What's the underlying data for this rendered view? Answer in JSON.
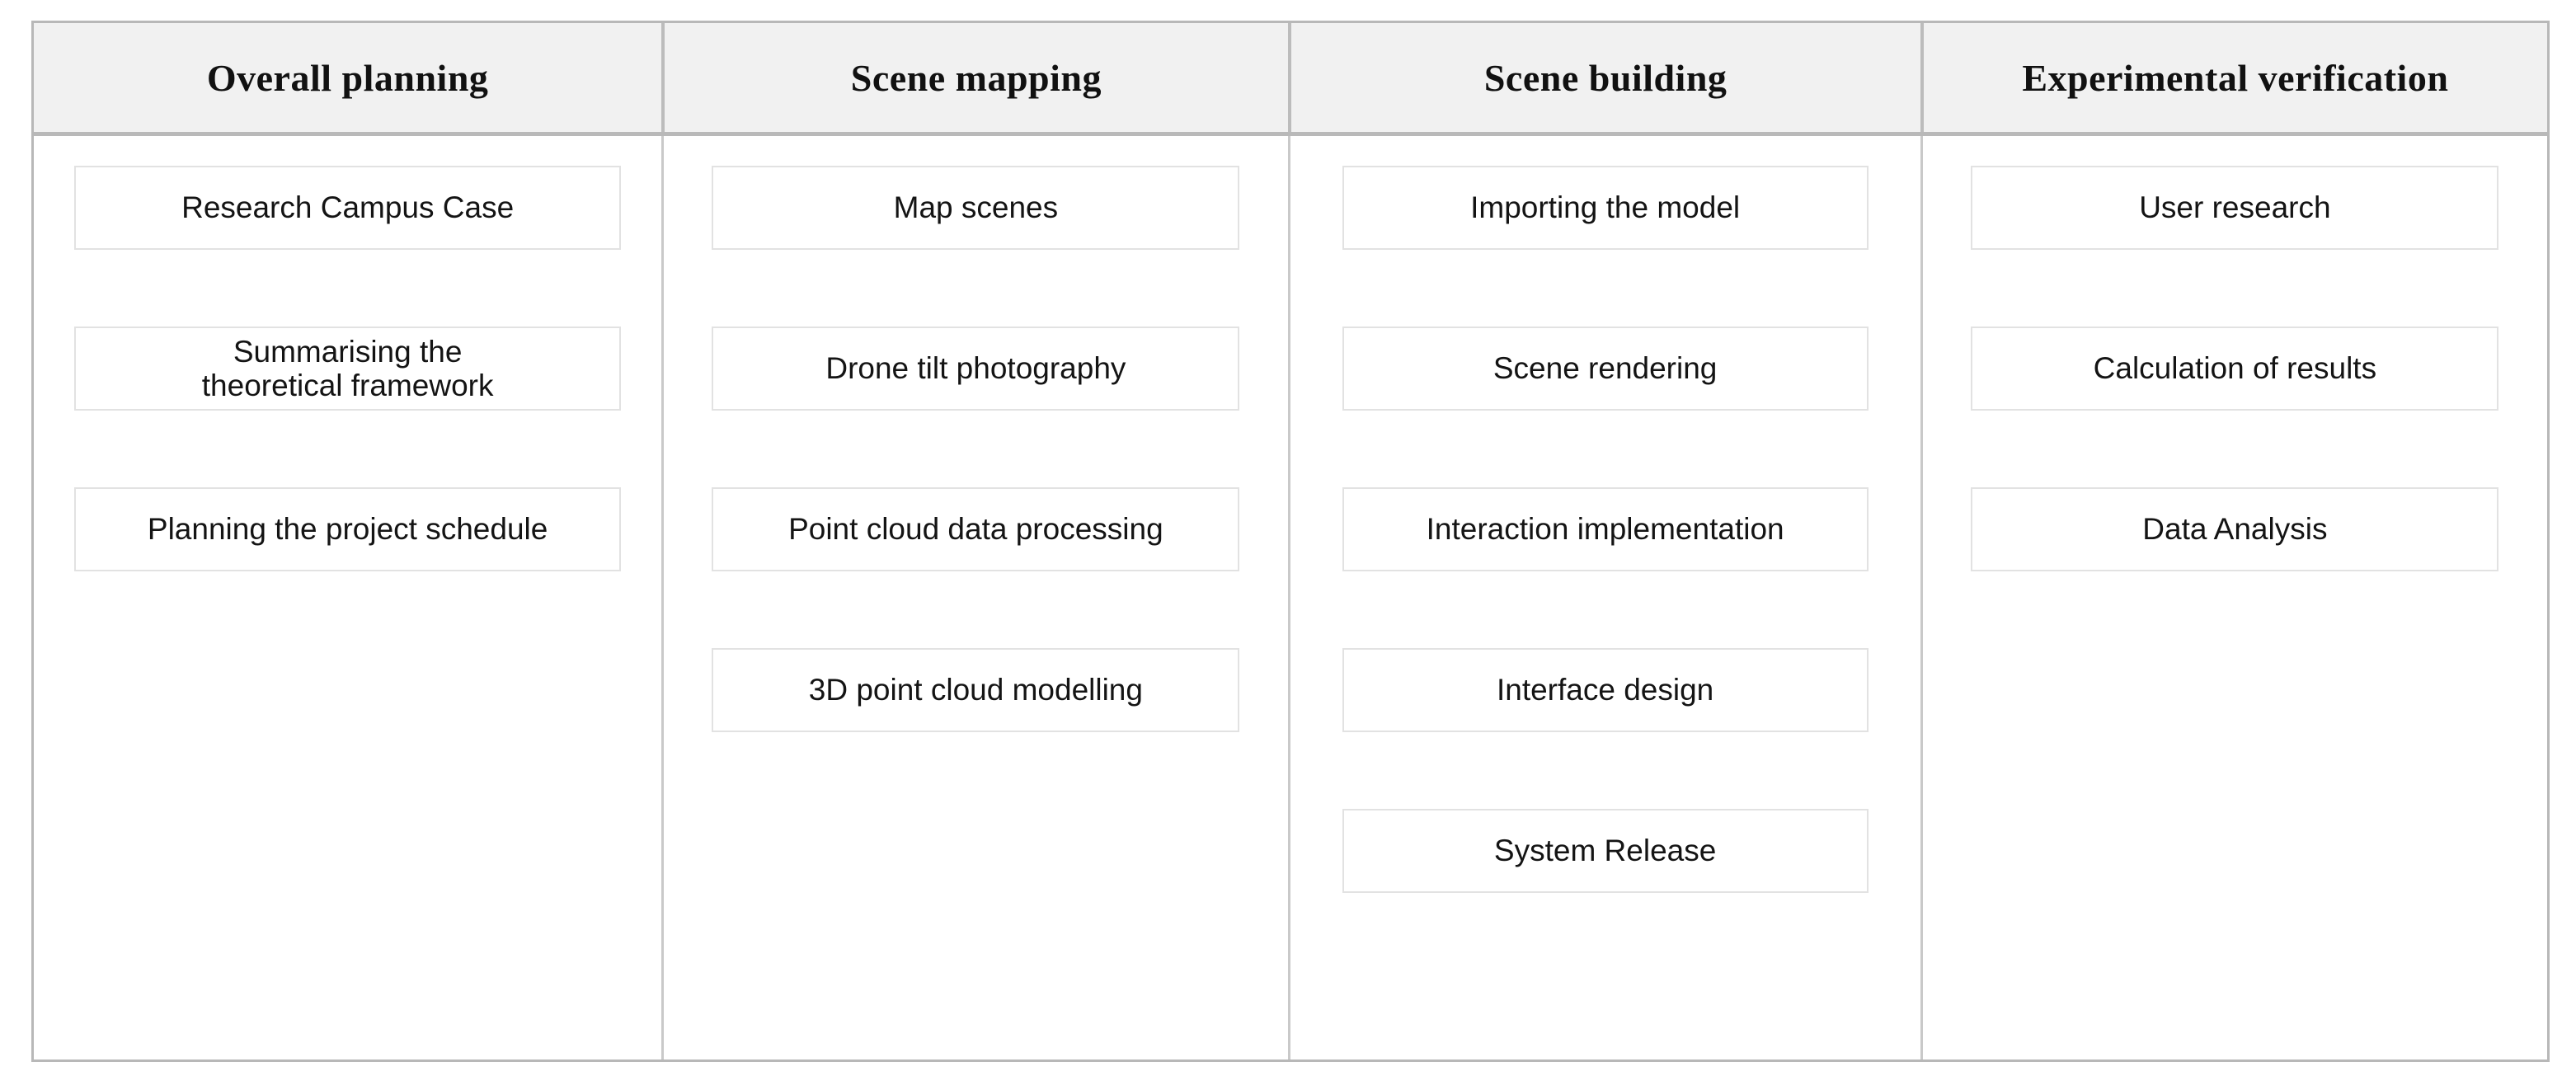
{
  "diagram": {
    "type": "four-column-process-table",
    "colors": {
      "outer_border": "#b8b8b8",
      "header_background": "#f1f1f1",
      "header_text": "#111111",
      "column_divider": "#c9c9c9",
      "box_border": "#e2e2e2",
      "box_background": "#ffffff",
      "body_text": "#141414",
      "page_background": "#ffffff"
    },
    "columns": [
      {
        "id": "overall-planning",
        "header": "Overall planning",
        "items": [
          {
            "label": "Research Campus Case",
            "lines": [
              "Research Campus Case"
            ]
          },
          {
            "label": "Summarising the theoretical framework",
            "lines": [
              "Summarising the",
              "theoretical framework"
            ]
          },
          {
            "label": "Planning the project schedule",
            "lines": [
              "Planning the project schedule"
            ]
          }
        ]
      },
      {
        "id": "scene-mapping",
        "header": "Scene mapping",
        "items": [
          {
            "label": "Map scenes",
            "lines": [
              "Map scenes"
            ]
          },
          {
            "label": "Drone tilt photography",
            "lines": [
              "Drone tilt photography"
            ]
          },
          {
            "label": "Point cloud data processing",
            "lines": [
              "Point cloud data processing"
            ]
          },
          {
            "label": "3D point cloud modelling",
            "lines": [
              "3D point cloud modelling"
            ]
          }
        ]
      },
      {
        "id": "scene-building",
        "header": "Scene building",
        "items": [
          {
            "label": "Importing the model",
            "lines": [
              "Importing the model"
            ]
          },
          {
            "label": "Scene rendering",
            "lines": [
              "Scene rendering"
            ]
          },
          {
            "label": "Interaction implementation",
            "lines": [
              "Interaction implementation"
            ]
          },
          {
            "label": "Interface design",
            "lines": [
              "Interface design"
            ]
          },
          {
            "label": "System Release",
            "lines": [
              "System Release"
            ]
          }
        ]
      },
      {
        "id": "experimental-verification",
        "header": "Experimental verification",
        "items": [
          {
            "label": "User research",
            "lines": [
              "User research"
            ]
          },
          {
            "label": "Calculation of results",
            "lines": [
              "Calculation of results"
            ]
          },
          {
            "label": "Data Analysis",
            "lines": [
              "Data Analysis"
            ]
          }
        ]
      }
    ]
  }
}
